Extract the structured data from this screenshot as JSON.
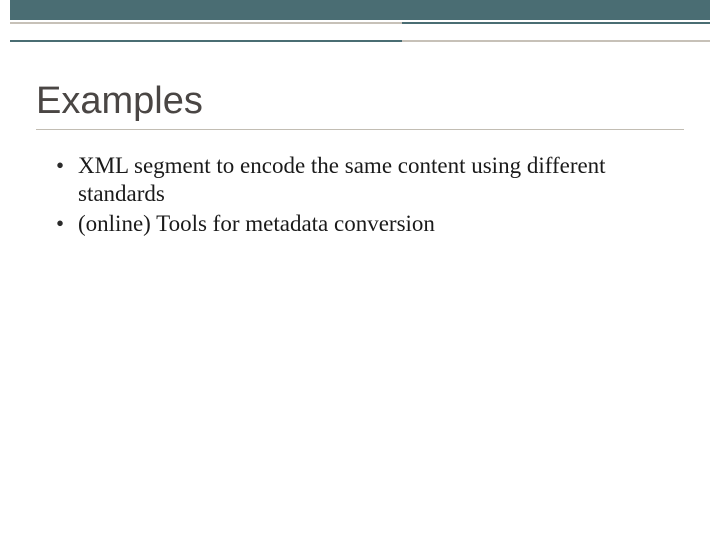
{
  "slide": {
    "title": "Examples",
    "bullets": [
      "XML segment to encode the same content using different standards",
      "(online) Tools for metadata conversion"
    ]
  }
}
